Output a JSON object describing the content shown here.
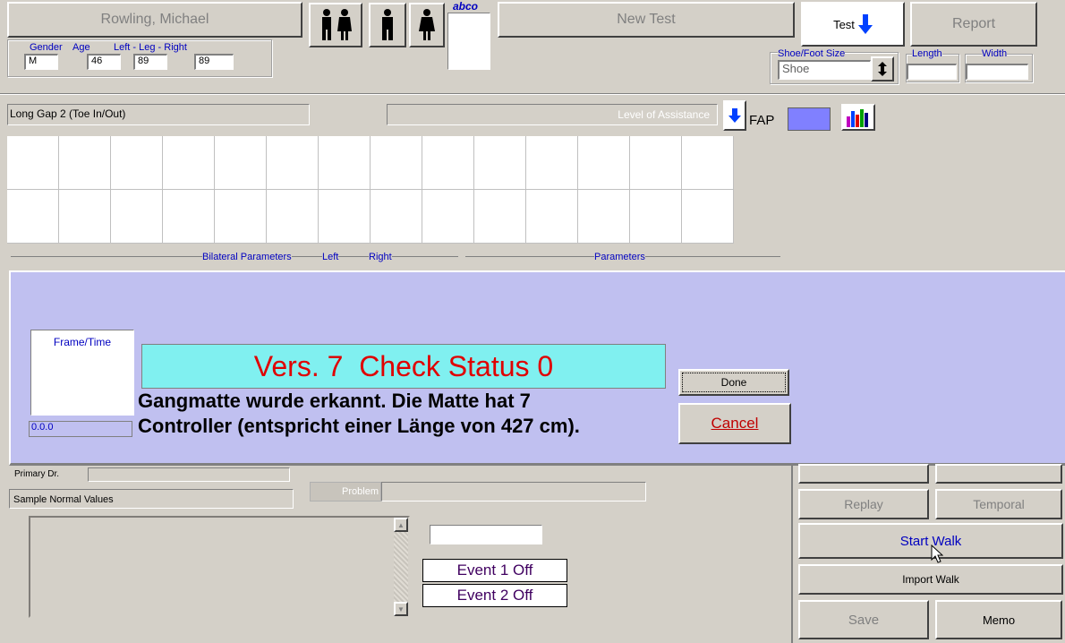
{
  "header": {
    "patient_name": "Rowling, Michael",
    "new_test_label": "New Test",
    "test_label": "Test",
    "report_label": "Report",
    "brand_label": "abco",
    "gender_label": "Gender",
    "age_label": "Age",
    "leg_label": "Left - Leg - Right",
    "gender_value": "M",
    "age_value": "46",
    "left_leg_value": "89",
    "right_leg_value": "89",
    "shoe_size_label": "Shoe/Foot Size",
    "shoe_value": "Shoe",
    "length_label": "Length",
    "width_label": "Width"
  },
  "main": {
    "test_title": "Long Gap 2 (Toe In/Out)",
    "level_assistance": "Level of Assistance",
    "fap_label": "FAP",
    "bilateral_params": "Bilateral Parameters",
    "left_label": "Left",
    "right_label": "Right",
    "parameters_label": "Parameters"
  },
  "dialog": {
    "frame_time_label": "Frame/Time",
    "frame_time_value": "0.0.0",
    "status_text": "Vers. 7  Check Status 0",
    "message_line1": "Gangmatte wurde erkannt. Die Matte hat 7",
    "message_line2": "Controller (entspricht einer Länge von 427 cm).",
    "done_label": "Done",
    "cancel_label": "Cancel"
  },
  "lower": {
    "primary_dr_label": "Primary Dr.",
    "sample_normal_values": "Sample Normal Values",
    "problem_label": "Problem",
    "event1": "Event 1 Off",
    "event2": "Event 2 Off",
    "replay_label": "Replay",
    "temporal_label": "Temporal",
    "start_walk_label": "Start Walk",
    "import_walk_label": "Import Walk",
    "save_label": "Save",
    "memo_label": "Memo"
  },
  "colors": {
    "dialog_bg": "#c0c0f0",
    "status_bg": "#80f0f0",
    "status_text": "#e00000",
    "fap_box": "#8080ff"
  }
}
